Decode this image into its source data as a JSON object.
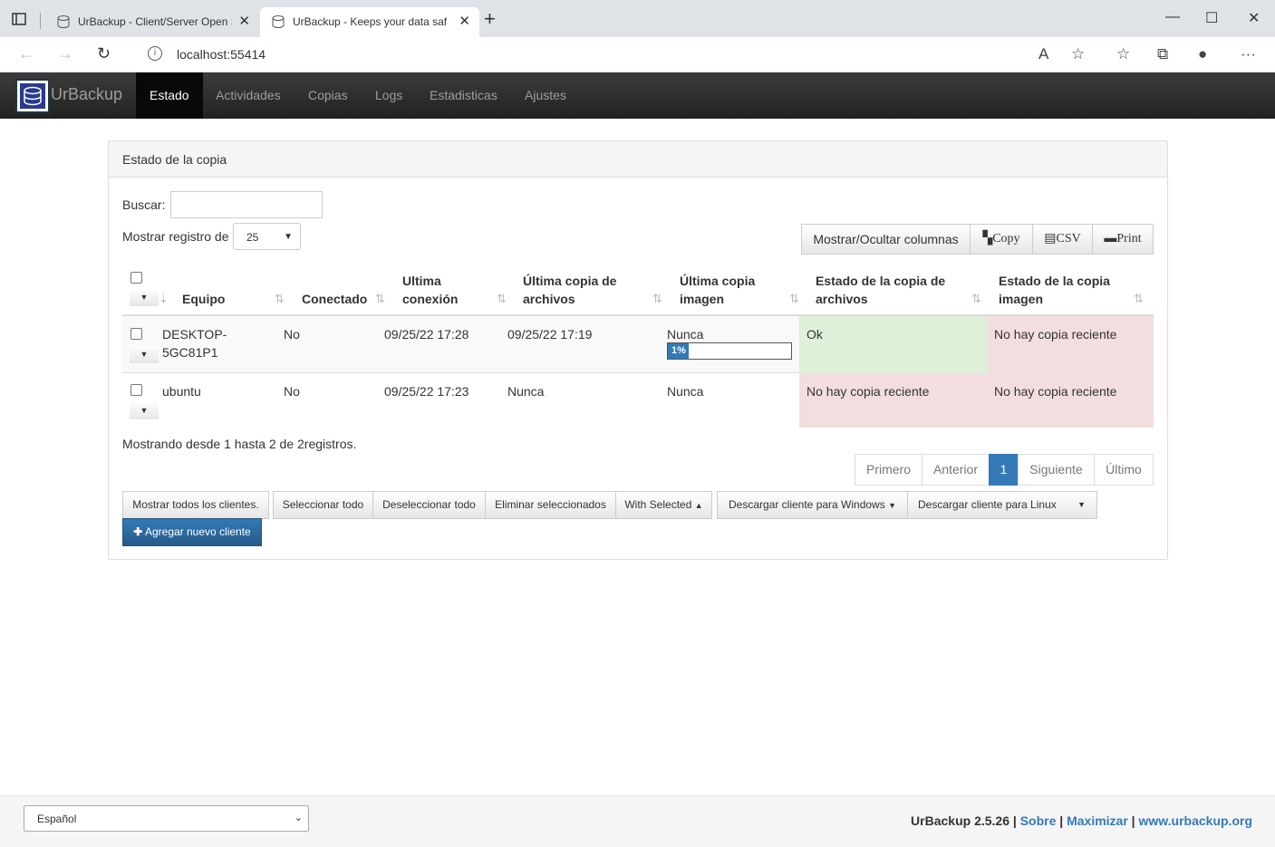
{
  "browser": {
    "tabs": [
      {
        "title": "UrBackup - Client/Server Open S",
        "active": false
      },
      {
        "title": "UrBackup - Keeps your data safe",
        "active": true
      }
    ],
    "url": "localhost:55414"
  },
  "app": {
    "brand": "UrBackup",
    "nav": [
      "Estado",
      "Actividades",
      "Copias",
      "Logs",
      "Estadisticas",
      "Ajustes"
    ],
    "active_nav": "Estado"
  },
  "panel": {
    "heading": "Estado de la copia",
    "search_label": "Buscar:",
    "length_label": "Mostrar registro de",
    "length_value": "25",
    "toolbar": {
      "columns": "Mostrar/Ocultar columnas",
      "copy": "Copy",
      "csv": "CSV",
      "print": "Print"
    },
    "columns": [
      "Equipo",
      "Conectado",
      "Ultima conexión",
      "Última copia de archivos",
      "Última copia imagen",
      "Estado de la copia de archivos",
      "Estado de la copia imagen"
    ],
    "rows": [
      {
        "equipo": "DESKTOP-5GC81P1",
        "conectado": "No",
        "ultima_conexion": "09/25/22 17:28",
        "ultima_archivos": "09/25/22 17:19",
        "ultima_imagen": "Nunca",
        "progress_percent": 1,
        "progress_label": "1%",
        "estado_archivos": "Ok",
        "estado_imagen": "No hay copia reciente"
      },
      {
        "equipo": "ubuntu",
        "conectado": "No",
        "ultima_conexion": "09/25/22 17:23",
        "ultima_archivos": "Nunca",
        "ultima_imagen": "Nunca",
        "estado_archivos": "No hay copia reciente",
        "estado_imagen": "No hay copia reciente"
      }
    ],
    "info": "Mostrando desde 1 hasta 2 de 2registros.",
    "pager": [
      "Primero",
      "Anterior",
      "1",
      "Siguiente",
      "Último"
    ],
    "buttons": {
      "show_all": "Mostrar todos los clientes.",
      "select_all": "Seleccionar todo",
      "deselect_all": "Deseleccionar todo",
      "delete_selected": "Eliminar seleccionados",
      "with_selected": "With Selected",
      "download_windows": "Descargar cliente para Windows",
      "download_linux": "Descargar cliente para Linux",
      "add_client": "Agregar nuevo cliente"
    }
  },
  "footer": {
    "language": "Español",
    "version": "UrBackup 2.5.26",
    "link_about": "Sobre",
    "link_maximize": "Maximizar",
    "link_site": "www.urbackup.org"
  },
  "colors": {
    "navbar": "#222222",
    "primary": "#337ab7",
    "success_bg": "#dff0d8",
    "danger_bg": "#f2dede"
  }
}
